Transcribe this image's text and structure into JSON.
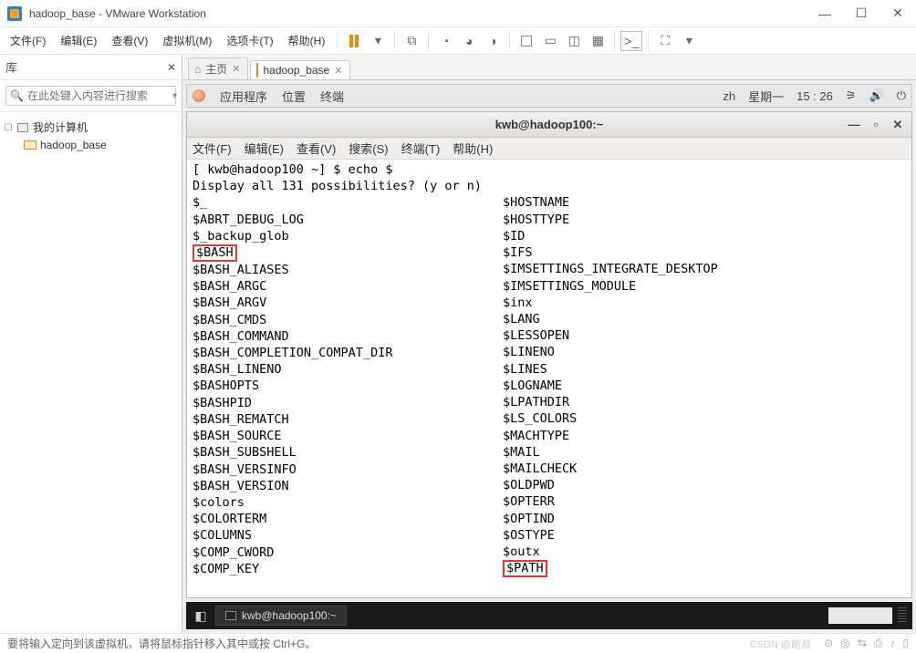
{
  "window": {
    "title": "hadoop_base - VMware Workstation"
  },
  "menu": {
    "file": "文件(F)",
    "edit": "编辑(E)",
    "view": "查看(V)",
    "vm": "虚拟机(M)",
    "tabs": "选项卡(T)",
    "help": "帮助(H)"
  },
  "library": {
    "title": "库",
    "search_placeholder": "在此处键入内容进行搜索",
    "root": "我的计算机",
    "item1": "hadoop_base"
  },
  "tabs": {
    "home": "主页",
    "vm": "hadoop_base"
  },
  "gnome": {
    "apps": "应用程序",
    "places": "位置",
    "terminal": "终端",
    "lang": "zh",
    "day": "星期一",
    "time": "15 : 26"
  },
  "term": {
    "title": "kwb@hadoop100:~",
    "menu": {
      "file": "文件(F)",
      "edit": "编辑(E)",
      "view": "查看(V)",
      "search": "搜索(S)",
      "terminal": "终端(T)",
      "help": "帮助(H)"
    },
    "prompt": "[ kwb@hadoop100 ~] $ echo $",
    "line2": "Display all 131 possibilities? (y or n)",
    "col1": {
      "v0": "$_",
      "v1": "$ABRT_DEBUG_LOG",
      "v2": "$_backup_glob",
      "v3": "$BASH",
      "v4": "$BASH_ALIASES",
      "v5": "$BASH_ARGC",
      "v6": "$BASH_ARGV",
      "v7": "$BASH_CMDS",
      "v8": "$BASH_COMMAND",
      "v9": "$BASH_COMPLETION_COMPAT_DIR",
      "v10": "$BASH_LINENO",
      "v11": "$BASHOPTS",
      "v12": "$BASHPID",
      "v13": "$BASH_REMATCH",
      "v14": "$BASH_SOURCE",
      "v15": "$BASH_SUBSHELL",
      "v16": "$BASH_VERSINFO",
      "v17": "$BASH_VERSION",
      "v18": "$colors",
      "v19": "$COLORTERM",
      "v20": "$COLUMNS",
      "v21": "$COMP_CWORD",
      "v22": "$COMP_KEY"
    },
    "col2": {
      "v0": "$HOSTNAME",
      "v1": "$HOSTTYPE",
      "v2": "$ID",
      "v3": "$IFS",
      "v4": "$IMSETTINGS_INTEGRATE_DESKTOP",
      "v5": "$IMSETTINGS_MODULE",
      "v6": "$inx",
      "v7": "$LANG",
      "v8": "$LESSOPEN",
      "v9": "$LINENO",
      "v10": "$LINES",
      "v11": "$LOGNAME",
      "v12": "$LPATHDIR",
      "v13": "$LS_COLORS",
      "v14": "$MACHTYPE",
      "v15": "$MAIL",
      "v16": "$MAILCHECK",
      "v17": "$OLDPWD",
      "v18": "$OPTERR",
      "v19": "$OPTIND",
      "v20": "$OSTYPE",
      "v21": "$outx",
      "v22": "$PATH"
    }
  },
  "taskbar": {
    "app": "kwb@hadoop100:~"
  },
  "status": {
    "hint": "要将输入定向到该虚拟机，请将鼠标指针移入其中或按 Ctrl+G。",
    "watermark": "CSDN @刷叔"
  }
}
